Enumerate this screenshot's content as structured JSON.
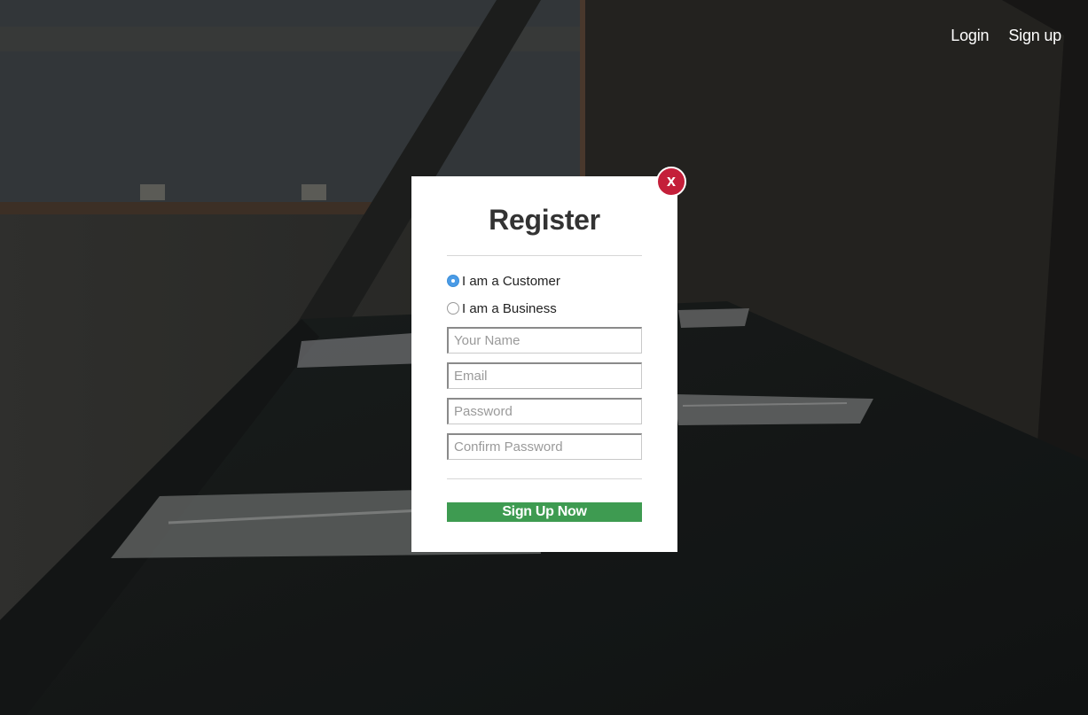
{
  "nav": {
    "login_label": "Login",
    "signup_label": "Sign up"
  },
  "modal": {
    "close_label": "x",
    "title": "Register",
    "account_type": {
      "options": [
        {
          "label": "I am a Customer",
          "checked": true
        },
        {
          "label": "I am a Business",
          "checked": false
        }
      ]
    },
    "fields": {
      "name_placeholder": "Your Name",
      "email_placeholder": "Email",
      "password_placeholder": "Password",
      "confirm_password_placeholder": "Confirm Password"
    },
    "submit_label": "Sign Up Now"
  },
  "colors": {
    "close_button": "#c41f3a",
    "submit_button": "#3e9b51",
    "radio_checked": "#4a9be6"
  }
}
